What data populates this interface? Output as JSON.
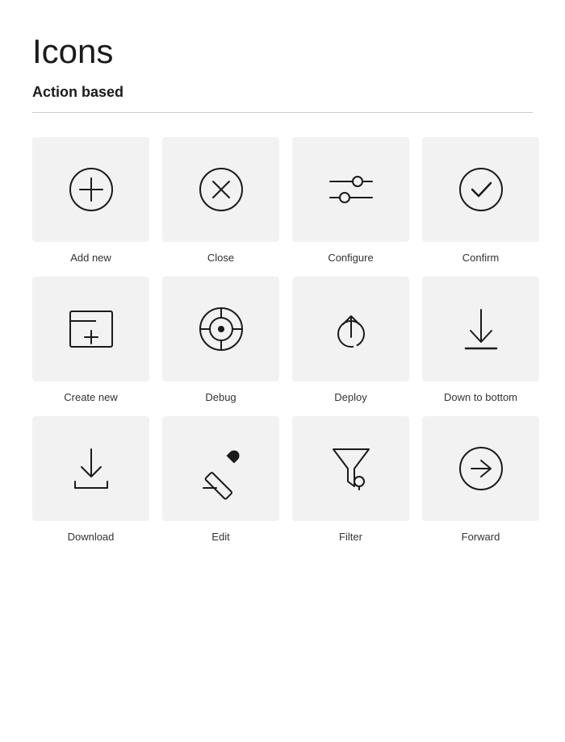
{
  "page": {
    "title": "Icons",
    "section": "Action based"
  },
  "icons": [
    {
      "name": "add-new-icon",
      "label": "Add new"
    },
    {
      "name": "close-icon",
      "label": "Close"
    },
    {
      "name": "configure-icon",
      "label": "Configure"
    },
    {
      "name": "confirm-icon",
      "label": "Confirm"
    },
    {
      "name": "create-new-icon",
      "label": "Create new"
    },
    {
      "name": "debug-icon",
      "label": "Debug"
    },
    {
      "name": "deploy-icon",
      "label": "Deploy"
    },
    {
      "name": "down-to-bottom-icon",
      "label": "Down to bottom"
    },
    {
      "name": "download-icon",
      "label": "Download"
    },
    {
      "name": "edit-icon",
      "label": "Edit"
    },
    {
      "name": "filter-icon",
      "label": "Filter"
    },
    {
      "name": "forward-icon",
      "label": "Forward"
    }
  ]
}
